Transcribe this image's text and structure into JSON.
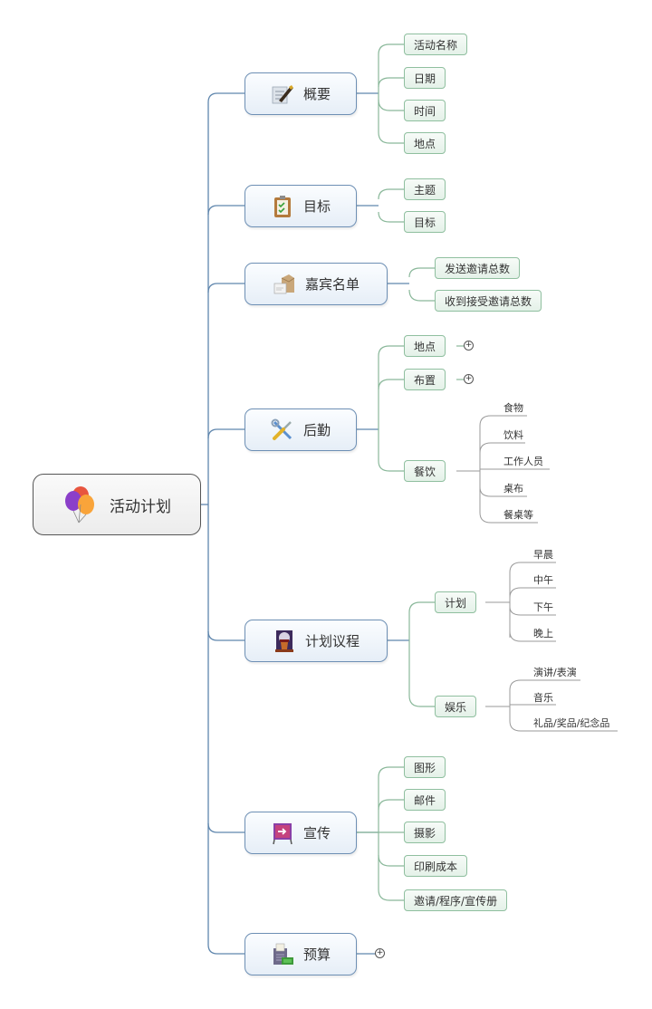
{
  "root": {
    "label": "活动计划",
    "icon": "balloons-icon"
  },
  "branches": [
    {
      "label": "概要",
      "icon": "pen-document-icon",
      "children": [
        {
          "label": "活动名称"
        },
        {
          "label": "日期"
        },
        {
          "label": "时间"
        },
        {
          "label": "地点"
        }
      ]
    },
    {
      "label": "目标",
      "icon": "clipboard-checklist-icon",
      "children": [
        {
          "label": "主题"
        },
        {
          "label": "目标"
        }
      ]
    },
    {
      "label": "嘉宾名单",
      "icon": "envelope-icon",
      "children": [
        {
          "label": "发送邀请总数"
        },
        {
          "label": "收到接受邀请总数"
        }
      ]
    },
    {
      "label": "后勤",
      "icon": "tools-icon",
      "children": [
        {
          "label": "地点",
          "collapsed": true
        },
        {
          "label": "布置",
          "collapsed": true
        },
        {
          "label": "餐饮",
          "children": [
            "食物",
            "饮料",
            "工作人员",
            "桌布",
            "餐桌等"
          ]
        }
      ]
    },
    {
      "label": "计划议程",
      "icon": "podium-icon",
      "children": [
        {
          "label": "计划",
          "children": [
            "早晨",
            "中午",
            "下午",
            "晚上"
          ]
        },
        {
          "label": "娱乐",
          "children": [
            "演讲/表演",
            "音乐",
            "礼品/奖品/纪念品"
          ]
        }
      ]
    },
    {
      "label": "宣传",
      "icon": "signboard-icon",
      "children": [
        {
          "label": "图形"
        },
        {
          "label": "邮件"
        },
        {
          "label": "摄影"
        },
        {
          "label": "印刷成本"
        },
        {
          "label": "邀请/程序/宣传册"
        }
      ]
    },
    {
      "label": "预算",
      "icon": "calculator-money-icon",
      "collapsed": true,
      "children": []
    }
  ],
  "expand_symbol": "+",
  "colors": {
    "main_border": "#6d8fb4",
    "main_line": "#5f86ad",
    "sub_border": "#8fbf9f",
    "sub_line": "#8ab89a",
    "leaf_line": "#9a9a9a",
    "root_border": "#555555"
  }
}
